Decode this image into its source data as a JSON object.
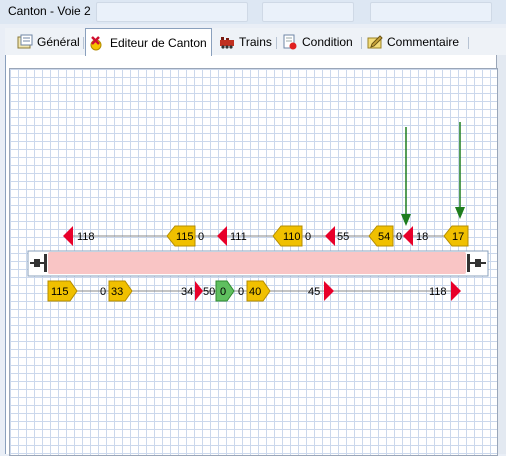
{
  "window": {
    "title": "Canton - Voie 2"
  },
  "tabs": [
    {
      "label": "Général",
      "icon": "general-icon"
    },
    {
      "label": "Editeur de Canton",
      "icon": "canton-editor-icon"
    },
    {
      "label": "Trains",
      "icon": "train-icon"
    },
    {
      "label": "Condition",
      "icon": "condition-icon"
    },
    {
      "label": "Commentaire",
      "icon": "comment-icon"
    }
  ],
  "active_tab": "Editeur de Canton",
  "editor": {
    "colors": {
      "track": "#f9c5c5",
      "limit_sign": "#f0c000",
      "red_marker": "#e8002a",
      "green_marker": "#5fbf5f",
      "arrow": "#1e7d1e"
    },
    "top_labels": [
      "118",
      "115",
      "0",
      "111",
      "110",
      "0",
      "55",
      "54",
      "0",
      "18",
      "17"
    ],
    "bottom_labels": [
      "115",
      "0",
      "33",
      "34",
      "50",
      "0",
      "0",
      "40",
      "45",
      "118"
    ]
  }
}
